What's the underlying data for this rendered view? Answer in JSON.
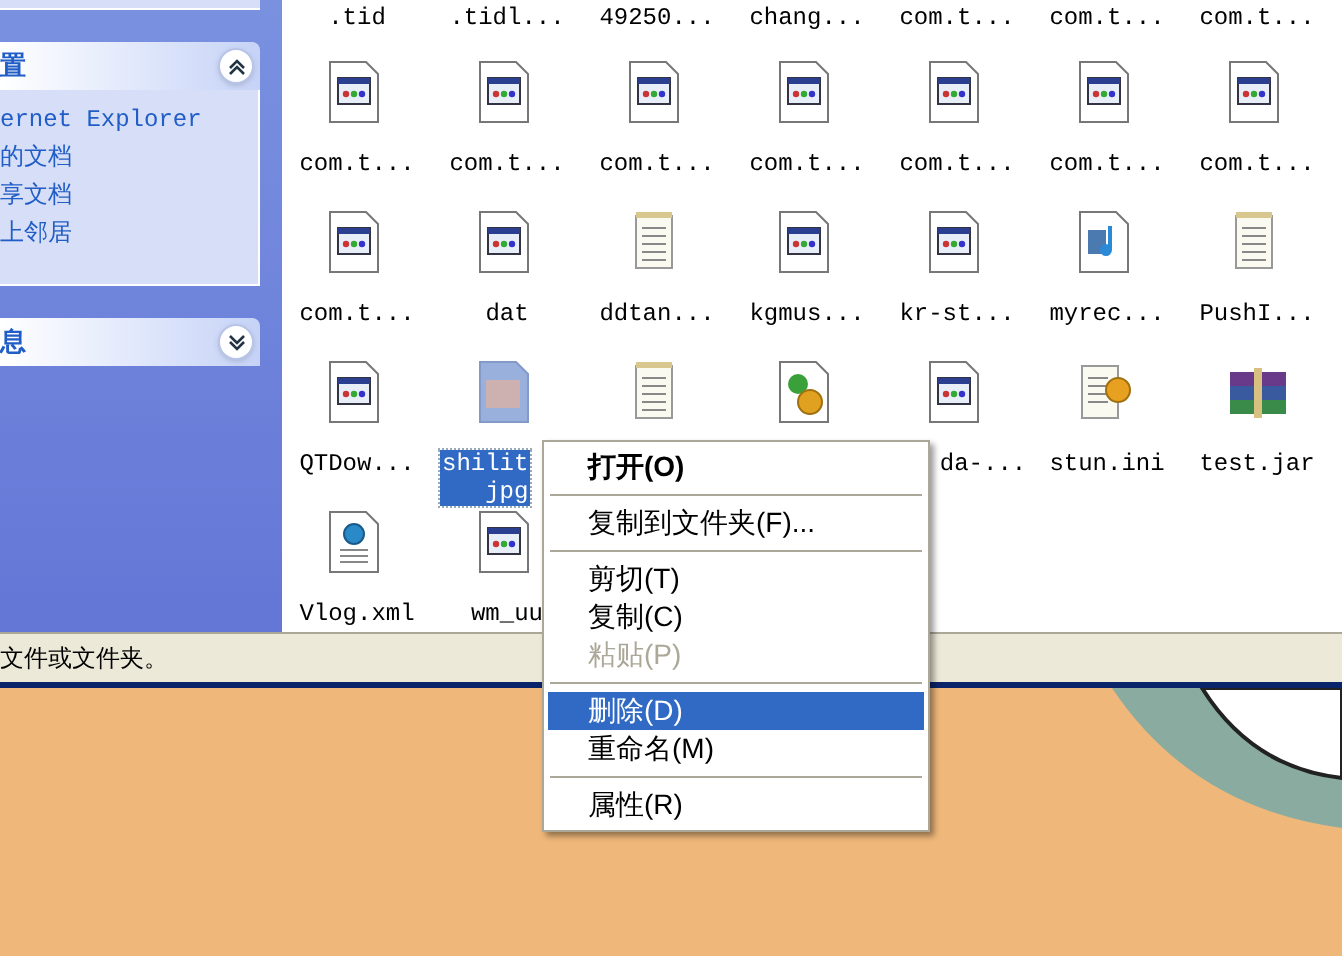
{
  "sidebar": {
    "panels": [
      {
        "title": "置",
        "expanded": true,
        "items": [
          "ernet Explorer",
          "的文档",
          "享文档",
          "上邻居"
        ]
      },
      {
        "title": "息",
        "expanded": false
      }
    ]
  },
  "files": {
    "top_row": [
      ".tid",
      ".tidl...",
      "49250...",
      "chang...",
      "com.t...",
      "com.t...",
      "com.t..."
    ],
    "rows": [
      [
        {
          "name": "com.t...",
          "kind": "app",
          "selected": false
        },
        {
          "name": "com.t...",
          "kind": "app",
          "selected": false
        },
        {
          "name": "com.t...",
          "kind": "app",
          "selected": false
        },
        {
          "name": "com.t...",
          "kind": "app",
          "selected": false
        },
        {
          "name": "com.t...",
          "kind": "app",
          "selected": false
        },
        {
          "name": "com.t...",
          "kind": "app",
          "selected": false
        },
        {
          "name": "com.t...",
          "kind": "app",
          "selected": false
        }
      ],
      [
        {
          "name": "com.t...",
          "kind": "app",
          "selected": false
        },
        {
          "name": "dat",
          "kind": "app",
          "selected": false
        },
        {
          "name": "ddtan...",
          "kind": "text",
          "selected": false
        },
        {
          "name": "kgmus...",
          "kind": "app",
          "selected": false
        },
        {
          "name": "kr-st...",
          "kind": "app",
          "selected": false
        },
        {
          "name": "myrec...",
          "kind": "media",
          "selected": false
        },
        {
          "name": "PushI...",
          "kind": "text",
          "selected": false
        }
      ],
      [
        {
          "name": "QTDow...",
          "kind": "app",
          "selected": false
        },
        {
          "name": "shilit",
          "name2": "jpg",
          "kind": "image",
          "selected": true
        },
        {
          "kind": "text",
          "selected": false
        },
        {
          "kind": "config",
          "selected": false
        },
        {
          "name": "da-...",
          "kind": "app",
          "selected": false,
          "cut": true
        },
        {
          "name": "stun.ini",
          "kind": "ini",
          "selected": false
        },
        {
          "name": "test.jar",
          "kind": "archive",
          "selected": false
        }
      ],
      [
        {
          "name": "Vlog.xml",
          "kind": "xml",
          "selected": false
        },
        {
          "name": "wm_uu",
          "kind": "app",
          "selected": false
        }
      ]
    ]
  },
  "context_menu": {
    "items": [
      {
        "kind": "item",
        "label": "打开(O)",
        "bold": true,
        "disabled": false,
        "selected": false
      },
      {
        "kind": "separator"
      },
      {
        "kind": "item",
        "label": "复制到文件夹(F)...",
        "bold": false,
        "disabled": false,
        "selected": false
      },
      {
        "kind": "separator"
      },
      {
        "kind": "item",
        "label": "剪切(T)",
        "bold": false,
        "disabled": false,
        "selected": false
      },
      {
        "kind": "item",
        "label": "复制(C)",
        "bold": false,
        "disabled": false,
        "selected": false
      },
      {
        "kind": "item",
        "label": "粘贴(P)",
        "bold": false,
        "disabled": true,
        "selected": false
      },
      {
        "kind": "separator"
      },
      {
        "kind": "item",
        "label": "删除(D)",
        "bold": false,
        "disabled": false,
        "selected": true
      },
      {
        "kind": "item",
        "label": "重命名(M)",
        "bold": false,
        "disabled": false,
        "selected": false
      },
      {
        "kind": "separator"
      },
      {
        "kind": "item",
        "label": "属性(R)",
        "bold": false,
        "disabled": false,
        "selected": false
      }
    ]
  },
  "status_bar": {
    "text": "文件或文件夹。"
  }
}
